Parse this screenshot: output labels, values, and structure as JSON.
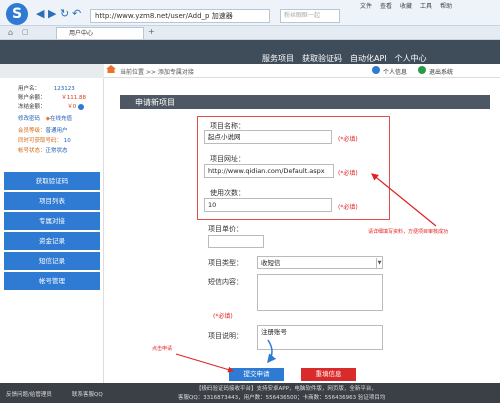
{
  "browser": {
    "logo": "S",
    "url": "http://www.yzm8.net/user/Add_p  加速器",
    "search_placeholder": "粉丝眼眶一起",
    "menu": [
      "文件",
      "查看",
      "收藏",
      "工具",
      "帮助"
    ],
    "tab_label": "用户中心",
    "tab_add": "+"
  },
  "topnav": [
    "服务项目",
    "获取验证码",
    "自动化API",
    "个人中心"
  ],
  "breadcrumb": {
    "text": "当前位置 >> 添加专属对接",
    "user": "个人信息",
    "exit": "退出系统"
  },
  "account": {
    "username_label": "用户名：",
    "username": "123123",
    "balance_label": "账户余额：",
    "balance": "￥111.88",
    "frozen_label": "冻结金额：",
    "frozen": "￥0",
    "change_pwd": "修改密码",
    "recharge": "在线充值",
    "level_label": "会员等级：",
    "level": "普通用户",
    "concurrent_label": "同时可获取号码：",
    "concurrent": "10",
    "status_label": "帐号状态：",
    "status": "正常状态"
  },
  "side_menu": [
    "获取验证码",
    "项目列表",
    "专属对接",
    "资金记录",
    "短信记录",
    "帐号管理"
  ],
  "form": {
    "panel_title": "申请新项目",
    "name_label": "项目名称：",
    "name_value": "起点小说网",
    "url_label": "项目网址：",
    "url_value": "http://www.qidian.com/Default.aspx",
    "count_label": "使用次数：",
    "count_value": "10",
    "price_label": "项目单价：",
    "price_value": "",
    "type_label": "项目类型：",
    "type_value": "收短信",
    "sms_label": "短信内容：",
    "desc_label": "项目说明：",
    "desc_value": "注册账号",
    "required": "(*必填)",
    "hint": "请详细填写资料，方便项目审核成功",
    "click_hint": "点击申请",
    "submit": "提交申请",
    "reset": "重填信息"
  },
  "footer": {
    "left1": "反馈问题/给管理员",
    "left2": "联系客服QQ",
    "line1": "【极码验证码接收平台】支持安卓APP，电脑软件版，网页版，全新平台，",
    "line2": "客服QQ：3316873443，用户数：556436500；卡商数：556436963 验证项目均"
  },
  "colors": {
    "accent": "#2f7bd3",
    "header": "#3f4c5a",
    "required": "#e02222",
    "reset": "#d92b2b"
  }
}
